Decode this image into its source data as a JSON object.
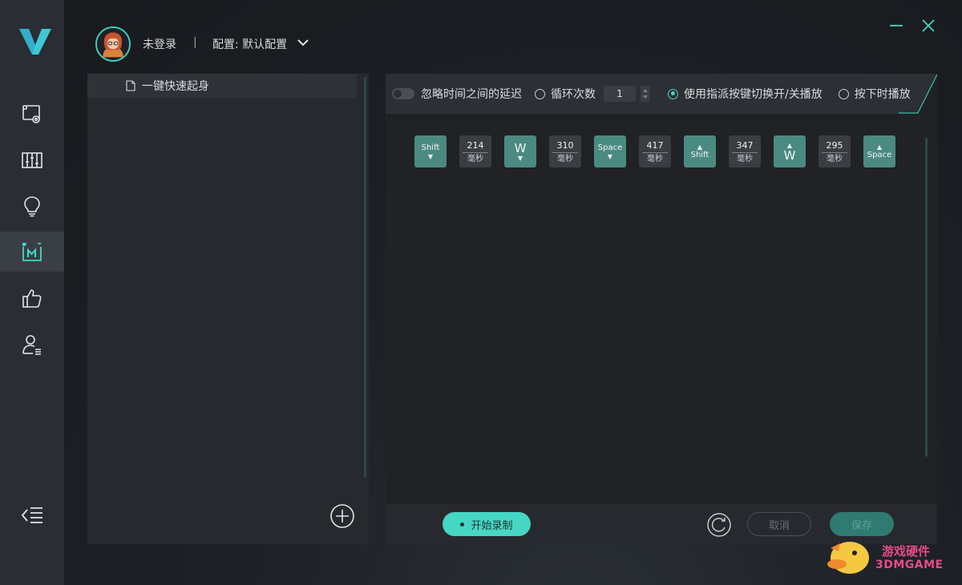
{
  "header": {
    "user_status": "未登录",
    "separator": "|",
    "config_label": "配置: 默认配置"
  },
  "macro_list": {
    "items": [
      {
        "label": "一键快速起身"
      }
    ]
  },
  "toolbar": {
    "ignore_delay_label": "忽略时间之间的延迟",
    "loop_label": "循环次数",
    "loop_value": "1",
    "toggle_mode_label": "使用指派按键切换开/关播放",
    "hold_mode_label": "按下时播放",
    "selected_mode": "toggle"
  },
  "sequence": [
    {
      "kind": "key",
      "label": "Shift",
      "dir": "down",
      "style": "teal"
    },
    {
      "kind": "delay",
      "value": "214",
      "unit": "毫秒"
    },
    {
      "kind": "key",
      "label": "W",
      "dir": "down",
      "style": "teal",
      "big": true
    },
    {
      "kind": "delay",
      "value": "310",
      "unit": "毫秒"
    },
    {
      "kind": "key",
      "label": "Space",
      "dir": "down",
      "style": "teal"
    },
    {
      "kind": "delay",
      "value": "417",
      "unit": "毫秒"
    },
    {
      "kind": "key",
      "label": "Shift",
      "dir": "up",
      "style": "teal"
    },
    {
      "kind": "delay",
      "value": "347",
      "unit": "毫秒"
    },
    {
      "kind": "key",
      "label": "W",
      "dir": "up",
      "style": "teal",
      "big": true
    },
    {
      "kind": "delay",
      "value": "295",
      "unit": "毫秒"
    },
    {
      "kind": "key",
      "label": "Space",
      "dir": "up",
      "style": "teal"
    }
  ],
  "bottom": {
    "record_label": "开始录制",
    "cancel_label": "取消",
    "save_label": "保存"
  },
  "watermark": {
    "line1": "游戏硬件",
    "line2": "3DMGAME"
  },
  "colors": {
    "accent": "#46d6c4",
    "key_bg": "#4b8a81",
    "delay_bg": "#3a3d42",
    "sidebar_bg": "#2a2d33"
  },
  "icons": {
    "sidebar": [
      "screen-settings-icon",
      "equalizer-icon",
      "lightbulb-icon",
      "macro-icon",
      "thumbs-up-icon",
      "user-list-icon"
    ]
  }
}
